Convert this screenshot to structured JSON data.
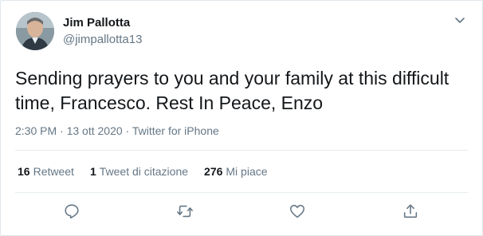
{
  "user": {
    "display_name": "Jim Pallotta",
    "handle": "@jimpallotta13",
    "avatar_icon": "profile-photo"
  },
  "tweet": {
    "text": "Sending prayers to you and your family at this difficult time, Francesco. Rest In Peace, Enzo",
    "meta": "2:30 PM · 13 ott 2020 · Twitter for iPhone"
  },
  "stats": {
    "retweets_count": "16",
    "retweets_label": "Retweet",
    "quotes_count": "1",
    "quotes_label": "Tweet di citazione",
    "likes_count": "276",
    "likes_label": "Mi piace"
  },
  "icons": {
    "menu": "chevron-down-icon",
    "reply": "reply-icon",
    "retweet": "retweet-icon",
    "like": "heart-icon",
    "share": "share-icon"
  },
  "colors": {
    "text": "#14171a",
    "secondary": "#657786",
    "border": "#e1e8ed"
  }
}
